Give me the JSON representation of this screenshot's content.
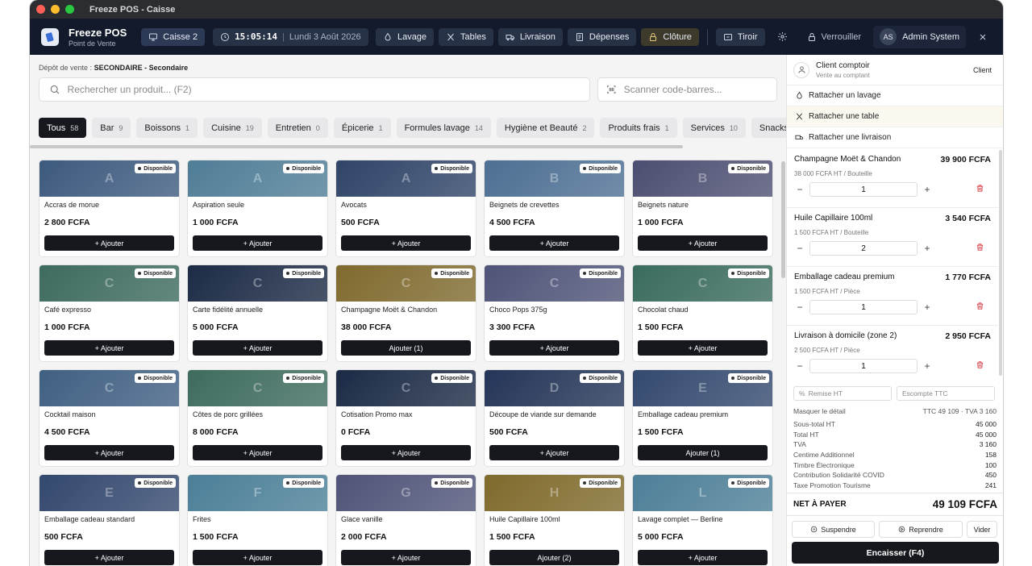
{
  "window": {
    "title": "Freeze POS - Caisse"
  },
  "brand": {
    "name": "Freeze POS",
    "subtitle": "Point de Vente"
  },
  "topbar": {
    "register": "Caisse 2",
    "time": "15:05:14",
    "date": "Lundi 3 Août 2026",
    "nav": [
      "Lavage",
      "Tables",
      "Livraison",
      "Dépenses",
      "Clôture",
      "Tiroir"
    ],
    "lock": "Verrouiller",
    "user_initials": "AS",
    "user_name": "Admin System"
  },
  "depot": {
    "label": "Dépôt de vente :",
    "value": "SECONDAIRE - Secondaire"
  },
  "search": {
    "placeholder": "Rechercher un produit... (F2)"
  },
  "scan": {
    "placeholder": "Scanner code-barres..."
  },
  "categories": [
    {
      "label": "Tous",
      "count": "58"
    },
    {
      "label": "Bar",
      "count": "9"
    },
    {
      "label": "Boissons",
      "count": "1"
    },
    {
      "label": "Cuisine",
      "count": "19"
    },
    {
      "label": "Entretien",
      "count": "0"
    },
    {
      "label": "Épicerie",
      "count": "1"
    },
    {
      "label": "Formules lavage",
      "count": "14"
    },
    {
      "label": "Hygiène et Beauté",
      "count": "2"
    },
    {
      "label": "Produits frais",
      "count": "1"
    },
    {
      "label": "Services",
      "count": "10"
    },
    {
      "label": "Snacks et C",
      "count": ""
    }
  ],
  "products": [
    {
      "letter": "A",
      "name": "Accras de morue",
      "price": "2 800 FCFA",
      "badge": "Disponible",
      "action": "+ Ajouter",
      "color": "#3c5a7e"
    },
    {
      "letter": "A",
      "name": "Aspiration seule",
      "price": "1 000 FCFA",
      "badge": "Disponible",
      "action": "+ Ajouter",
      "color": "#4f7d96"
    },
    {
      "letter": "A",
      "name": "Avocats",
      "price": "500 FCFA",
      "badge": "Disponible",
      "action": "+ Ajouter",
      "color": "#2f4468"
    },
    {
      "letter": "B",
      "name": "Beignets de crevettes",
      "price": "4 500 FCFA",
      "badge": "Disponible",
      "action": "+ Ajouter",
      "color": "#4d6f93"
    },
    {
      "letter": "B",
      "name": "Beignets nature",
      "price": "1 000 FCFA",
      "badge": "Disponible",
      "action": "+ Ajouter",
      "color": "#4d4f72"
    },
    {
      "letter": "C",
      "name": "Café expresso",
      "price": "1 000 FCFA",
      "badge": "Disponible",
      "action": "+ Ajouter",
      "color": "#3d6a5f"
    },
    {
      "letter": "C",
      "name": "Carte fidélité annuelle",
      "price": "5 000 FCFA",
      "badge": "Disponible",
      "action": "+ Ajouter",
      "color": "#1c2a45"
    },
    {
      "letter": "C",
      "name": "Champagne Moët & Chandon",
      "price": "38 000 FCFA",
      "badge": "Disponible",
      "action": "Ajouter (1)",
      "color": "#7f6a2e"
    },
    {
      "letter": "C",
      "name": "Choco Pops 375g",
      "price": "3 300 FCFA",
      "badge": "Disponible",
      "action": "+ Ajouter",
      "color": "#4f5478"
    },
    {
      "letter": "C",
      "name": "Chocolat chaud",
      "price": "1 500 FCFA",
      "badge": "Disponible",
      "action": "+ Ajouter",
      "color": "#3a6b5e"
    },
    {
      "letter": "C",
      "name": "Cocktail maison",
      "price": "4 500 FCFA",
      "badge": "Disponible",
      "action": "+ Ajouter",
      "color": "#3f5f82"
    },
    {
      "letter": "C",
      "name": "Côtes de porc grillées",
      "price": "8 000 FCFA",
      "badge": "Disponible",
      "action": "+ Ajouter",
      "color": "#3e6b5e"
    },
    {
      "letter": "C",
      "name": "Cotisation Promo max",
      "price": "0 FCFA",
      "badge": "Disponible",
      "action": "+ Ajouter",
      "color": "#1b2a45"
    },
    {
      "letter": "D",
      "name": "Découpe de viande sur demande",
      "price": "500 FCFA",
      "badge": "Disponible",
      "action": "+ Ajouter",
      "color": "#243457"
    },
    {
      "letter": "E",
      "name": "Emballage cadeau premium",
      "price": "1 500 FCFA",
      "badge": "Disponible",
      "action": "Ajouter (1)",
      "color": "#33496e"
    },
    {
      "letter": "E",
      "name": "Emballage cadeau standard",
      "price": "500 FCFA",
      "badge": "Disponible",
      "action": "+ Ajouter",
      "color": "#33486e"
    },
    {
      "letter": "F",
      "name": "Frites",
      "price": "1 500 FCFA",
      "badge": "Disponible",
      "action": "+ Ajouter",
      "color": "#4b7f97"
    },
    {
      "letter": "G",
      "name": "Glace vanille",
      "price": "2 000 FCFA",
      "badge": "Disponible",
      "action": "+ Ajouter",
      "color": "#4f5478"
    },
    {
      "letter": "H",
      "name": "Huile Capillaire 100ml",
      "price": "1 500 FCFA",
      "badge": "Disponible",
      "action": "Ajouter (2)",
      "color": "#7f6a2c"
    },
    {
      "letter": "L",
      "name": "Lavage complet — Berline",
      "price": "5 000 FCFA",
      "badge": "Disponible",
      "action": "+ Ajouter",
      "color": "#4d7f97"
    }
  ],
  "client": {
    "name": "Client comptoir",
    "sub": "Vente au comptant",
    "button": "Client"
  },
  "attach": [
    "Rattacher un lavage",
    "Rattacher une table",
    "Rattacher une livraison"
  ],
  "cart": [
    {
      "name": "Champagne Moët & Chandon",
      "total": "39 900 FCFA",
      "unit": "38 000 FCFA HT / Bouteille",
      "qty": "1"
    },
    {
      "name": "Huile Capillaire 100ml",
      "total": "3 540 FCFA",
      "unit": "1 500 FCFA HT / Bouteille",
      "qty": "2"
    },
    {
      "name": "Emballage cadeau premium",
      "total": "1 770 FCFA",
      "unit": "1 500 FCFA HT / Pièce",
      "qty": "1"
    },
    {
      "name": "Livraison à domicile (zone 2)",
      "total": "2 950 FCFA",
      "unit": "2 500 FCFA HT / Pièce",
      "qty": "1"
    }
  ],
  "discount": {
    "remise": "Remise HT",
    "escompte": "Escompte TTC"
  },
  "summary": {
    "masquer": "Masquer le détail",
    "ttc_tva": "TTC 49 109 · TVA 3 160",
    "rows": [
      {
        "label": "Sous-total HT",
        "value": "45 000"
      },
      {
        "label": "Total HT",
        "value": "45 000"
      },
      {
        "label": "TVA",
        "value": "3 160"
      },
      {
        "label": "Centime Additionnel",
        "value": "158"
      },
      {
        "label": "Timbre Électronique",
        "value": "100"
      },
      {
        "label": "Contribution Solidarité COVID",
        "value": "450"
      },
      {
        "label": "Taxe Promotion Tourisme",
        "value": "241"
      }
    ]
  },
  "net": {
    "label": "NET À PAYER",
    "value": "49 109 FCFA"
  },
  "actions": {
    "suspend": "Suspendre",
    "resume": "Reprendre",
    "clear": "Vider",
    "pay": "Encaisser (F4)"
  }
}
